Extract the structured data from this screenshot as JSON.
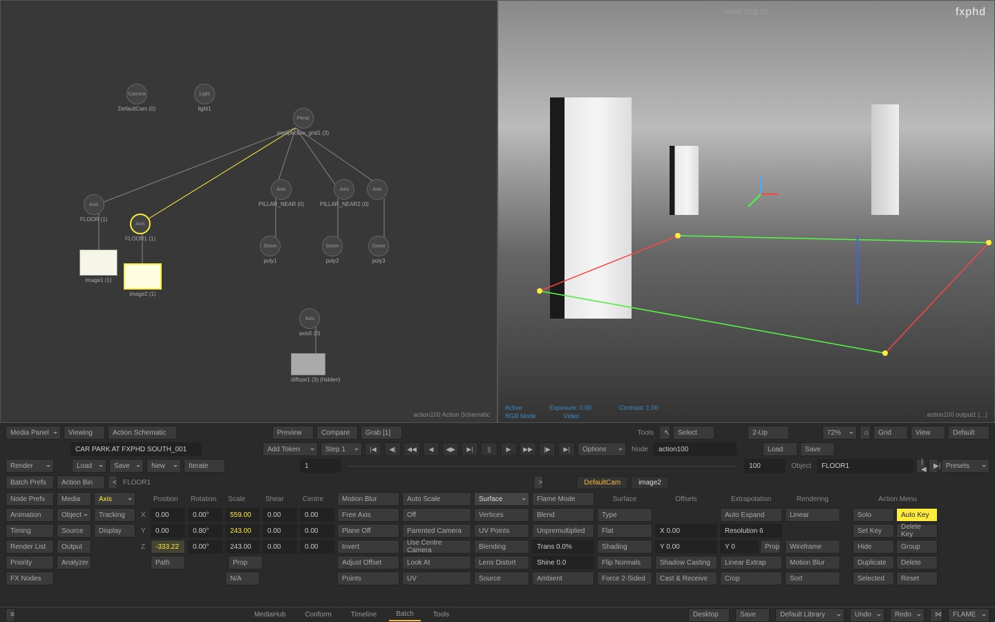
{
  "watermark": {
    "url": "www.rrcg.cn",
    "logo": "fxphd"
  },
  "schematic": {
    "footer": "action100 Action Schematic",
    "nodes": {
      "camera": {
        "type": "Camera",
        "label": "DefaultCam (0)"
      },
      "light": {
        "type": "Light",
        "label": "light1"
      },
      "pgrid": {
        "type": "Perspective Grid",
        "label": "perspective_grid1 (3)"
      },
      "axis1": {
        "type": "Axis",
        "label": "FLOOR (1)"
      },
      "axis2": {
        "type": "Axis",
        "label": "FLOOR1 (1)"
      },
      "axis3": {
        "type": "Axis",
        "label": "PILLAR_NEAR (0)"
      },
      "axis4": {
        "type": "Axis",
        "label": "PILLAR_NEAR2 (0)"
      },
      "axis4b": {
        "type": "Axis",
        "label": "PILLAR_NEAR2 (0)"
      },
      "axis5": {
        "type": "Axis",
        "label": "axis5 (0)"
      },
      "image1": {
        "label": "image1 (1)"
      },
      "image2": {
        "label": "image2 (1)"
      },
      "geom1": {
        "type": "Geom",
        "label": "poly1"
      },
      "geom2": {
        "type": "Geom",
        "label": "poly2"
      },
      "geom3": {
        "type": "Geom",
        "label": "poly3"
      },
      "diffuse": {
        "label": "diffuse1 (3) (hidden)"
      }
    }
  },
  "rightview": {
    "rgb": "RGB Mode",
    "video": "Video",
    "active": "Active",
    "exposure": "Exposure: 0.00",
    "contrast": "Contrast: 1.00",
    "footer": "action100 output1 (...)"
  },
  "toolbar1": {
    "media_panel": "Media Panel",
    "viewing": "Viewing",
    "action_schematic": "Action Schematic",
    "preview": "Preview",
    "compare": "Compare",
    "grab": "Grab [1]",
    "tools": "Tools",
    "select": "Select",
    "twoup": "2-Up",
    "zoom": "72%",
    "grid": "Grid",
    "view": "View",
    "default": "Default"
  },
  "toolbar2": {
    "project": "CAR PARK AT FXPHD SOUTH_001",
    "add_token": "Add Token",
    "step": "Step 1",
    "frame_cur": "1",
    "frame_end": "100",
    "options": "Options",
    "node": "Node",
    "node_val": "action100",
    "load": "Load",
    "save": "Save"
  },
  "toolbar3": {
    "render": "Render",
    "load": "Load",
    "save": "Save",
    "new": "New",
    "iterate": "Iterate",
    "object": "Object",
    "object_val": "FLOOR1",
    "presets": "Presets"
  },
  "tabs": {
    "default_cam": "DefaultCam",
    "image2": "image2"
  },
  "leftcol": {
    "batch_prefs": "Batch Prefs",
    "action_bin": "Action Bin",
    "floor1": "FLOOR1",
    "node_prefs": "Node Prefs",
    "media": "Media",
    "axis": "Axis",
    "animation": "Animation",
    "object": "Object",
    "tracking": "Tracking",
    "timing": "Timing",
    "source": "Source",
    "display": "Display",
    "render_list": "Render List",
    "output": "Output",
    "priority": "Priority",
    "analyzer": "Analyzer",
    "fx_nodes": "FX Nodes"
  },
  "xform": {
    "position": "Position",
    "rotation": "Rotation",
    "scale": "Scale",
    "shear": "Shear",
    "centre": "Centre",
    "x": "X",
    "y": "Y",
    "z": "Z",
    "px": "0.00",
    "rx": "0.00°",
    "sx": "559.00",
    "shx": "0.00",
    "cx": "0.00",
    "py": "0.00",
    "ry": "0.80°",
    "sy": "243.00",
    "shy": "0.00",
    "cy": "0.00",
    "pz": "-333.22",
    "rz": "0.00°",
    "sz": "243.00",
    "shz": "0.00",
    "cz": "0.00",
    "path": "Path",
    "prop": "Prop",
    "na": "N/A"
  },
  "midcol1": {
    "motion_blur": "Motion Blur",
    "free_axis": "Free Axis",
    "plane_off": "Plane Off",
    "invert": "Invert",
    "adjust_offset": "Adjust Offset",
    "points": "Points"
  },
  "midcol2": {
    "auto_scale": "Auto Scale",
    "off": "Off",
    "parented_camera": "Parented Camera",
    "use_centre": "Use Centre Camera",
    "look_at": "Look At",
    "uv": "UV"
  },
  "midcol3": {
    "surface": "Surface",
    "vertices": "Vertices",
    "uv_points": "UV Points",
    "blending": "Blending",
    "lens_distort": "Lens Distort",
    "source": "Source"
  },
  "midcol4": {
    "flame_mode": "Flame Mode",
    "blend": "Blend",
    "unpremultiplied": "Unpremultiplied",
    "trans": "Trans 0.0%",
    "shine": "Shine 0.0",
    "ambient": "Ambient"
  },
  "midcol5": {
    "surface": "Surface",
    "type": "Type",
    "flat": "Flat",
    "shading": "Shading",
    "flip_normals": "Flip Normals",
    "force2": "Force 2-Sided"
  },
  "midcol6": {
    "offsets": "Offsets",
    "x": "X 0.00",
    "y": "Y 0.00",
    "shadow_casting": "Shadow Casting",
    "cast_receive": "Cast & Receive"
  },
  "midcol7": {
    "extrapolation": "Extrapolation",
    "auto_expand": "Auto Expand",
    "resolution": "Resolution 6",
    "y0": "Y 0",
    "prop": "Prop",
    "linear_extrap": "Linear Extrap",
    "crop": "Crop"
  },
  "midcol8": {
    "rendering": "Rendering",
    "linear": "Linear",
    "wireframe": "Wireframe",
    "motion_blur": "Motion Blur",
    "sort": "Sort"
  },
  "rightcol": {
    "action_menu": "Action Menu",
    "solo": "Solo",
    "auto_key": "Auto Key",
    "set_key": "Set Key",
    "delete_key": "Delete Key",
    "hide": "Hide",
    "group": "Group",
    "duplicate": "Duplicate",
    "delete": "Delete",
    "selected": "Selected",
    "reset": "Reset"
  },
  "bottombar": {
    "mediahub": "MediaHub",
    "conform": "Conform",
    "timeline": "Timeline",
    "batch": "Batch",
    "tools": "Tools",
    "desktop": "Desktop",
    "save": "Save",
    "default_library": "Default Library",
    "undo": "Undo",
    "redo": "Redo",
    "flame": "FLAME"
  }
}
